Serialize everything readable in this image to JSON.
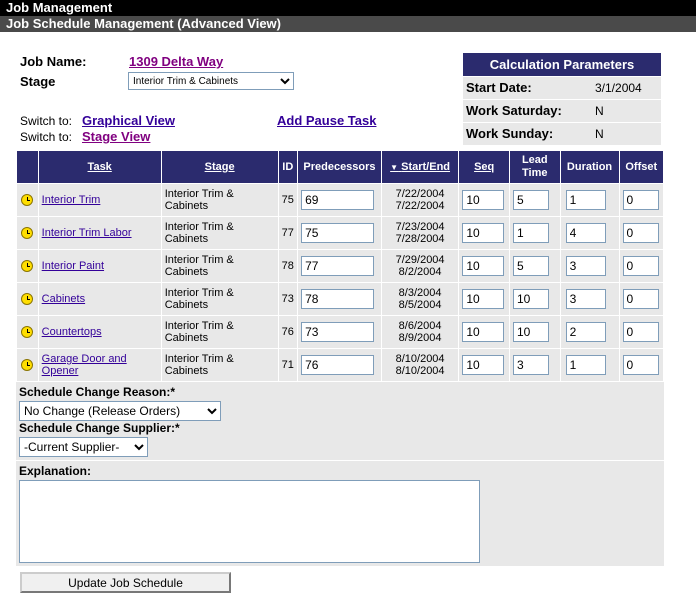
{
  "header": {
    "title": "Job Management",
    "subtitle": "Job Schedule Management (Advanced View)"
  },
  "job": {
    "name_label": "Job Name:",
    "name_value": "1309 Delta Way",
    "stage_label": "Stage",
    "stage_value": "Interior Trim & Cabinets"
  },
  "switch": {
    "prefix1": "Switch to:",
    "graphical": "Graphical View",
    "prefix2": "Switch to:",
    "stage": "Stage View",
    "add_pause": "Add Pause Task"
  },
  "calc": {
    "title": "Calculation Parameters",
    "start_label": "Start Date:",
    "start_value": "3/1/2004",
    "sat_label": "Work Saturday:",
    "sat_value": "N",
    "sun_label": "Work Sunday:",
    "sun_value": "N"
  },
  "columns": {
    "task": "Task",
    "stage": "Stage",
    "id": "ID",
    "pred": "Predecessors",
    "startend": "Start/End",
    "seq": "Seq",
    "lead": "Lead Time",
    "duration": "Duration",
    "offset": "Offset"
  },
  "rows": [
    {
      "task": "Interior Trim",
      "stage": "Interior Trim & Cabinets",
      "id": "75",
      "pred": "69",
      "start": "7/22/2004",
      "end": "7/22/2004",
      "seq": "10",
      "lead": "5",
      "duration": "1",
      "offset": "0"
    },
    {
      "task": "Interior Trim Labor",
      "stage": "Interior Trim & Cabinets",
      "id": "77",
      "pred": "75",
      "start": "7/23/2004",
      "end": "7/28/2004",
      "seq": "10",
      "lead": "1",
      "duration": "4",
      "offset": "0"
    },
    {
      "task": "Interior Paint",
      "stage": "Interior Trim & Cabinets",
      "id": "78",
      "pred": "77",
      "start": "7/29/2004",
      "end": "8/2/2004",
      "seq": "10",
      "lead": "5",
      "duration": "3",
      "offset": "0"
    },
    {
      "task": "Cabinets",
      "stage": "Interior Trim & Cabinets",
      "id": "73",
      "pred": "78",
      "start": "8/3/2004",
      "end": "8/5/2004",
      "seq": "10",
      "lead": "10",
      "duration": "3",
      "offset": "0"
    },
    {
      "task": "Countertops",
      "stage": "Interior Trim & Cabinets",
      "id": "76",
      "pred": "73",
      "start": "8/6/2004",
      "end": "8/9/2004",
      "seq": "10",
      "lead": "10",
      "duration": "2",
      "offset": "0"
    },
    {
      "task": "Garage Door and Opener",
      "stage": "Interior Trim & Cabinets",
      "id": "71",
      "pred": "76",
      "start": "8/10/2004",
      "end": "8/10/2004",
      "seq": "10",
      "lead": "3",
      "duration": "1",
      "offset": "0"
    }
  ],
  "form": {
    "reason_label": "Schedule Change Reason:*",
    "reason_value": "No Change (Release Orders)",
    "supplier_label": "Schedule Change Supplier:*",
    "supplier_value": "-Current Supplier-",
    "explanation_label": "Explanation:",
    "submit": "Update Job Schedule"
  }
}
